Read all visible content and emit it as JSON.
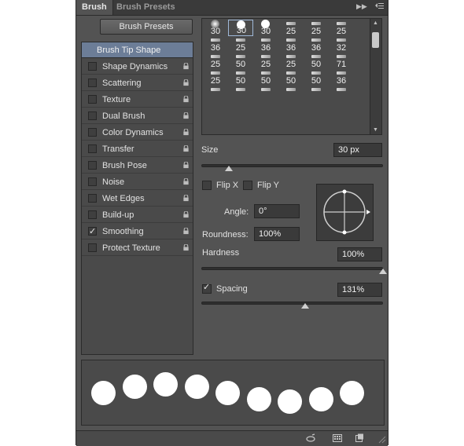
{
  "tabs": {
    "brush": "Brush",
    "brush_presets": "Brush Presets"
  },
  "buttons": {
    "brush_presets": "Brush Presets"
  },
  "options": {
    "header": "Brush Tip Shape",
    "items": [
      {
        "label": "Shape Dynamics",
        "checked": false
      },
      {
        "label": "Scattering",
        "checked": false
      },
      {
        "label": "Texture",
        "checked": false
      },
      {
        "label": "Dual Brush",
        "checked": false
      },
      {
        "label": "Color Dynamics",
        "checked": false
      },
      {
        "label": "Transfer",
        "checked": false
      },
      {
        "label": "Brush Pose",
        "checked": false
      },
      {
        "label": "Noise",
        "checked": false
      },
      {
        "label": "Wet Edges",
        "checked": false
      },
      {
        "label": "Build-up",
        "checked": false
      },
      {
        "label": "Smoothing",
        "checked": true
      },
      {
        "label": "Protect Texture",
        "checked": false
      }
    ]
  },
  "brush_grid": {
    "sizes": [
      "30",
      "30",
      "30",
      "25",
      "25",
      "25",
      "36",
      "25",
      "36",
      "36",
      "36",
      "32",
      "25",
      "50",
      "25",
      "25",
      "50",
      "71",
      "25",
      "50",
      "50",
      "50",
      "50",
      "36",
      "",
      "",
      "",
      "",
      "",
      ""
    ],
    "selected_index": 1
  },
  "tip": {
    "size_label": "Size",
    "size_value": "30 px",
    "size_fraction": 0.15,
    "flip_x_label": "Flip X",
    "flip_y_label": "Flip Y",
    "angle_label": "Angle:",
    "angle_value": "0°",
    "roundness_label": "Roundness:",
    "roundness_value": "100%",
    "hardness_label": "Hardness",
    "hardness_value": "100%",
    "hardness_fraction": 1.0,
    "spacing_label": "Spacing",
    "spacing_value": "131%",
    "spacing_checked": true,
    "spacing_fraction": 0.57
  },
  "preview": {
    "dot_count": 9
  }
}
